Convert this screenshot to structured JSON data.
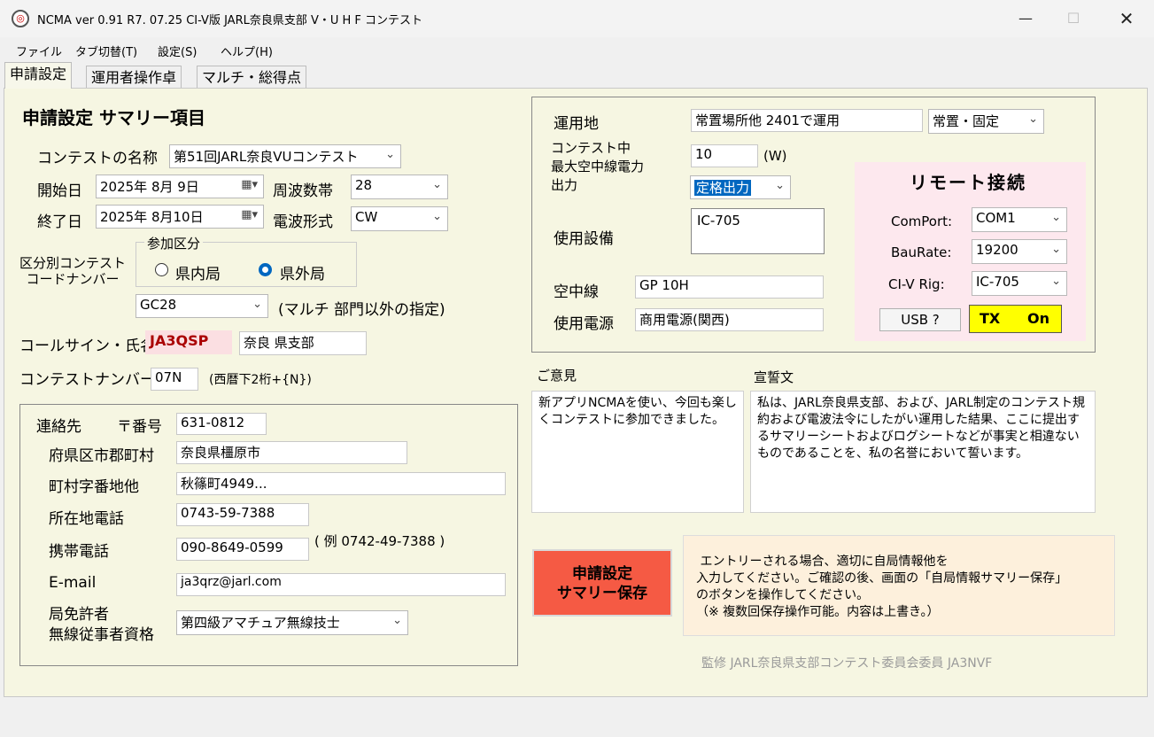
{
  "window": {
    "title": "NCMA ver 0.91  R7. 07.25 CI-V版 JARL奈良県支部 V・U H F コンテスト"
  },
  "menu": {
    "items": [
      "ファイル",
      "タブ切替(T)",
      "設定(S)",
      "ヘルプ(H)"
    ]
  },
  "tabs": [
    "申請設定",
    "運用者操作卓",
    "マルチ・総得点"
  ],
  "summary": {
    "heading": "申請設定  サマリー項目",
    "contest_name_label": "コンテストの名称",
    "contest_name_value": "第51回JARL奈良VUコンテスト",
    "start_label": "開始日",
    "start_value": "2025年 8月 9日",
    "end_label": "終了日",
    "end_value": "2025年 8月10日",
    "band_label": "周波数帯",
    "band_value": "28",
    "mode_label": "電波形式",
    "mode_value": "CW",
    "category_label": "区分別コンテスト\nコードナンバー",
    "participation_group": "参加区分",
    "radio_inside": "県内局",
    "radio_outside": "県外局",
    "code_value": "GC28",
    "code_note": "(マルチ 部門以外の指定)",
    "callsign_label": "コールサイン・氏名",
    "callsign_value": "JA3QSP",
    "name_value": "奈良 県支部",
    "number_label": "コンテストナンバー",
    "number_value": "07N",
    "number_note": "(西暦下2桁+{N})"
  },
  "contact": {
    "label": "連絡先",
    "zip_label": "〒番号",
    "zip_value": "631-0812",
    "pref_label": "府県区市郡町村",
    "pref_value": "奈良県橿原市",
    "addr_label": "町村字番地他",
    "addr_value": "秋篠町4949...",
    "phone_label": "所在地電話",
    "phone_value": "0743-59-7388",
    "mobile_label": "携帯電話",
    "mobile_value": "090-8649-0599",
    "phone_example": "( 例 0742-49-7388 )",
    "email_label": "E-mail",
    "email_value": "ja3qrz@jarl.com",
    "license_label": "局免許者\n無線従事者資格",
    "license_value": "第四級アマチュア無線技士"
  },
  "operation": {
    "location_label": "運用地",
    "location_value": "常置場所他 2401で運用",
    "location_type": "常置・固定",
    "power_label": "コンテスト中\n最大空中線電力\n出力",
    "power_value": "10",
    "power_unit": "(W)",
    "power_type": "定格出力",
    "equipment_label": "使用設備",
    "equipment_value": "IC-705",
    "antenna_label": "空中線",
    "antenna_value": "GP 10H",
    "source_label": "使用電源",
    "source_value": "商用電源(関西)"
  },
  "remote": {
    "title": "リモート接続",
    "comport_label": "ComPort:",
    "comport_value": "COM1",
    "baud_label": "BauRate:",
    "baud_value": "19200",
    "civ_label": "CI-V Rig:",
    "civ_value": "IC-705",
    "usb_button": "USB ?",
    "tx_label": "TX",
    "tx_state": "On"
  },
  "opinion": {
    "label": "ご意見",
    "text": "新アプリNCMAを使い、今回も楽しくコンテストに参加できました。"
  },
  "oath": {
    "label": "宣誓文",
    "text": "私は、JARL奈良県支部、および、JARL制定のコンテスト規約および電波法令にしたがい運用した結果、ここに提出するサマリーシートおよびログシートなどが事実と相違ないものであることを、私の名誉において誓います。"
  },
  "save": {
    "button": "申請設定\nサマリー保存",
    "help": " エントリーされる場合、適切に自局情報他を\n入力してください。ご確認の後、画面の「自局情報サマリー保存」\nのボタンを操作してください。\n（※ 複数回保存操作可能。内容は上書き。）"
  },
  "footer": {
    "credit": "監修 JARL奈良県支部コンテスト委員会委員 JA3NVF"
  },
  "colors": {
    "panel": "#f6f6e2",
    "remote_bg": "#fde8ee",
    "save_button": "#f55a44",
    "tx_bg": "#ffff00",
    "callsign_bg": "#fbdfe2",
    "help_bg": "#fdf0dc"
  }
}
